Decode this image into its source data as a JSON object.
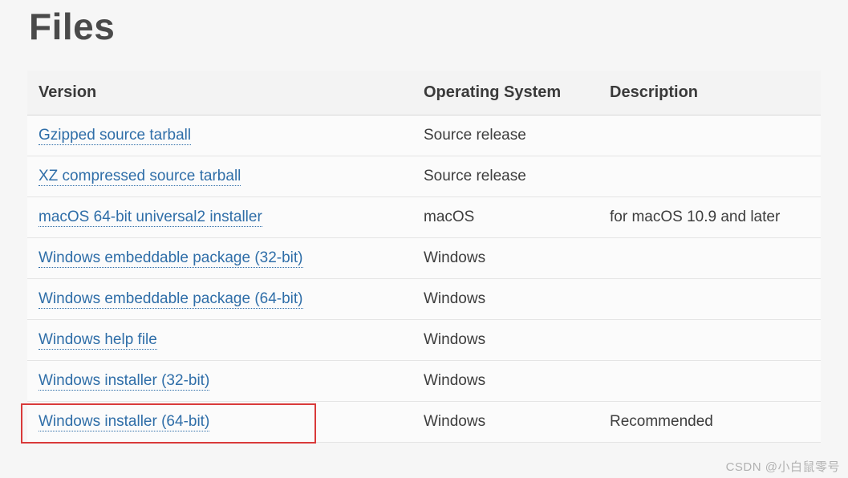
{
  "heading": "Files",
  "columns": [
    "Version",
    "Operating System",
    "Description"
  ],
  "rows": [
    {
      "version": "Gzipped source tarball",
      "os": "Source release",
      "desc": "",
      "highlight": false
    },
    {
      "version": "XZ compressed source tarball",
      "os": "Source release",
      "desc": "",
      "highlight": false
    },
    {
      "version": "macOS 64-bit universal2 installer",
      "os": "macOS",
      "desc": "for macOS 10.9 and later",
      "highlight": false
    },
    {
      "version": "Windows embeddable package (32-bit)",
      "os": "Windows",
      "desc": "",
      "highlight": false
    },
    {
      "version": "Windows embeddable package (64-bit)",
      "os": "Windows",
      "desc": "",
      "highlight": false
    },
    {
      "version": "Windows help file",
      "os": "Windows",
      "desc": "",
      "highlight": false
    },
    {
      "version": "Windows installer (32-bit)",
      "os": "Windows",
      "desc": "",
      "highlight": false
    },
    {
      "version": "Windows installer (64-bit)",
      "os": "Windows",
      "desc": "Recommended",
      "highlight": true
    }
  ],
  "watermark": "CSDN @小白鼠零号"
}
